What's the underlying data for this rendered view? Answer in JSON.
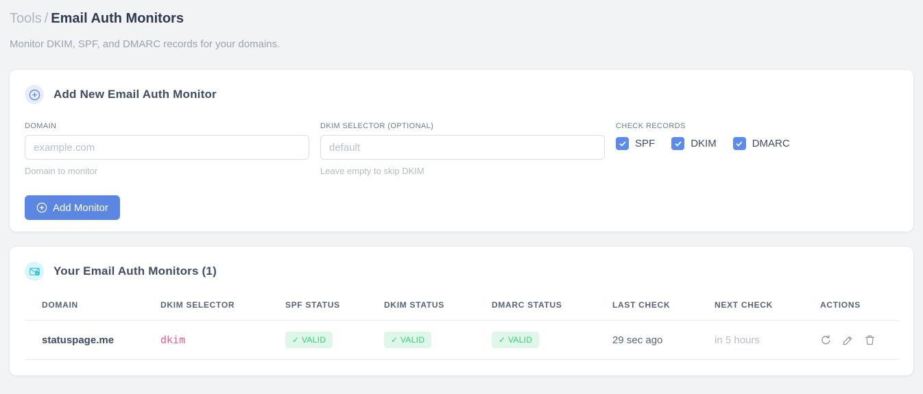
{
  "breadcrumb": {
    "section": "Tools",
    "separator": "/",
    "current": "Email Auth Monitors"
  },
  "subtitle": "Monitor DKIM, SPF, and DMARC records for your domains.",
  "colors": {
    "accent_blue": "#5b87e3",
    "checkbox_blue": "#5b8cec",
    "badge_green_bg": "#def7e8",
    "badge_green_text": "#31d07c",
    "selector_pink": "#e75c8d",
    "icon_cyan": "#27c4e2",
    "page_bg": "#f2f3f5"
  },
  "add_form": {
    "title": "Add New Email Auth Monitor",
    "icon": "plus-circle-icon",
    "fields": {
      "domain": {
        "label": "DOMAIN",
        "value": "",
        "placeholder": "example.com",
        "hint": "Domain to monitor"
      },
      "dkim_selector": {
        "label": "DKIM SELECTOR (OPTIONAL)",
        "value": "",
        "placeholder": "default",
        "hint": "Leave empty to skip DKIM"
      }
    },
    "check_records": {
      "label": "CHECK RECORDS",
      "options": [
        {
          "label": "SPF",
          "checked": true
        },
        {
          "label": "DKIM",
          "checked": true
        },
        {
          "label": "DMARC",
          "checked": true
        }
      ]
    },
    "submit_label": "Add Monitor"
  },
  "monitors": {
    "title": "Your Email Auth Monitors (1)",
    "count": 1,
    "icon": "email-check-icon",
    "columns": [
      "DOMAIN",
      "DKIM SELECTOR",
      "SPF STATUS",
      "DKIM STATUS",
      "DMARC STATUS",
      "LAST CHECK",
      "NEXT CHECK",
      "ACTIONS"
    ],
    "rows": [
      {
        "domain": "statuspage.me",
        "dkim_selector": "dkim",
        "spf_status": "✓ VALID",
        "dkim_status": "✓ VALID",
        "dmarc_status": "✓ VALID",
        "last_check": "29 sec ago",
        "next_check": "in 5 hours",
        "actions": [
          "refresh",
          "edit",
          "delete"
        ]
      }
    ]
  }
}
